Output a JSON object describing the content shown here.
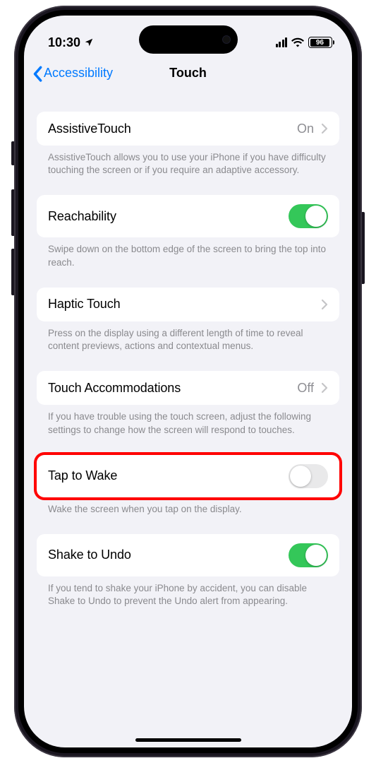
{
  "status": {
    "time": "10:30",
    "battery_pct": "96",
    "battery_fill_pct": 96
  },
  "nav": {
    "back_label": "Accessibility",
    "title": "Touch"
  },
  "rows": {
    "assistive": {
      "label": "AssistiveTouch",
      "value": "On",
      "footer": "AssistiveTouch allows you to use your iPhone if you have difficulty touching the screen or if you require an adaptive accessory."
    },
    "reachability": {
      "label": "Reachability",
      "toggle": true,
      "footer": "Swipe down on the bottom edge of the screen to bring the top into reach."
    },
    "haptic": {
      "label": "Haptic Touch",
      "footer": "Press on the display using a different length of time to reveal content previews, actions and contextual menus."
    },
    "accommodations": {
      "label": "Touch Accommodations",
      "value": "Off",
      "footer": "If you have trouble using the touch screen, adjust the following settings to change how the screen will respond to touches."
    },
    "tap_to_wake": {
      "label": "Tap to Wake",
      "toggle": false,
      "footer": "Wake the screen when you tap on the display."
    },
    "shake_to_undo": {
      "label": "Shake to Undo",
      "toggle": true,
      "footer": "If you tend to shake your iPhone by accident, you can disable Shake to Undo to prevent the Undo alert from appearing."
    }
  },
  "colors": {
    "accent": "#007aff",
    "toggle_on": "#34c759",
    "highlight": "#ff0000"
  }
}
